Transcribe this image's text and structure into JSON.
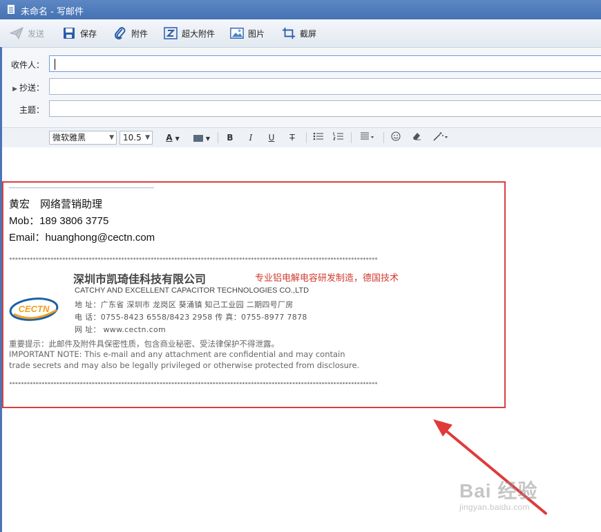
{
  "window": {
    "title": "未命名 - 写邮件"
  },
  "toolbar": {
    "send_label": "发送",
    "save_label": "保存",
    "attach_label": "附件",
    "large_attach_label": "超大附件",
    "image_label": "图片",
    "screenshot_label": "截屏"
  },
  "header": {
    "to_label": "收件人：",
    "cc_label": "抄送：",
    "subject_label": "主题：",
    "to_value": "",
    "cc_value": "",
    "subject_value": ""
  },
  "format": {
    "font_family": "微软雅黑",
    "font_size": "10.5",
    "font_color_glyph": "A",
    "bold_glyph": "B",
    "italic_glyph": "I",
    "underline_glyph": "U",
    "strike_glyph": "T"
  },
  "signature": {
    "name_line": "黄宏　网络营销助理",
    "mobile_line": "Mob：189 3806 3775",
    "email_line": "Email：huanghong@cectn.com",
    "stars": "*****************************************************************************************************************************",
    "company_cn": "深圳市凯琦佳科技有限公司",
    "slogan": "专业铝电解电容研发制造，德国技术",
    "company_en": "CATCHY AND EXCELLENT CAPACITOR TECHNOLOGIES CO.,LTD",
    "address": "地  址：广东省 深圳市 龙岗区 葵涌镇 知己工业园  二期四号厂房",
    "phone": "电  话：0755-8423 6558/8423 2958   传  真：0755-8977 7878",
    "website": "网  址：  www.cectn.com",
    "logo_text": "CECTN",
    "note_cn": "重要提示：此邮件及附件具保密性质，包含商业秘密、受法律保护不得泄露。",
    "note_en_1": "IMPORTANT NOTE: This e-mail and any attachment are confidential and may contain",
    "note_en_2": "trade secrets and may also be legally privileged or otherwise protected from disclosure."
  },
  "watermark": {
    "main": "Bai 经验",
    "sub": "jingyan.baidu.com"
  },
  "colors": {
    "title_bar": "#4572b3",
    "highlight_border": "#d8403f",
    "slogan": "#d13a2e",
    "logo_blue": "#1b5fa8",
    "logo_orange": "#f0a01e"
  }
}
